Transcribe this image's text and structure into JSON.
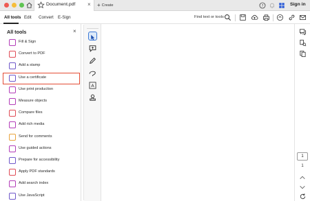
{
  "window": {
    "tab_title": "Document.pdf",
    "create_label": "Create",
    "sign_in_label": "Sign in"
  },
  "menu": {
    "items": [
      "All tools",
      "Edit",
      "Convert",
      "E-Sign"
    ],
    "active": "All tools",
    "find_label": "Find text or tools"
  },
  "panel": {
    "title": "All tools",
    "highlighted_item": "Use a certificate",
    "tools": [
      {
        "label": "Fill & Sign",
        "icon": "fill-sign-icon",
        "color": "#b23cb8"
      },
      {
        "label": "Convert to PDF",
        "icon": "convert-pdf-icon",
        "color": "#e04b55"
      },
      {
        "label": "Add a stamp",
        "icon": "stamp-icon",
        "color": "#6e57c9"
      },
      {
        "label": "Use a certificate",
        "icon": "certificate-icon",
        "color": "#6e57c9"
      },
      {
        "label": "Use print production",
        "icon": "print-production-icon",
        "color": "#b23cb8"
      },
      {
        "label": "Measure objects",
        "icon": "measure-icon",
        "color": "#b23cb8"
      },
      {
        "label": "Compare files",
        "icon": "compare-files-icon",
        "color": "#e04b55"
      },
      {
        "label": "Add rich media",
        "icon": "rich-media-icon",
        "color": "#b23cb8"
      },
      {
        "label": "Send for comments",
        "icon": "send-comments-icon",
        "color": "#e8a33c"
      },
      {
        "label": "Use guided actions",
        "icon": "guided-actions-icon",
        "color": "#b23cb8"
      },
      {
        "label": "Prepare for accessibility",
        "icon": "accessibility-icon",
        "color": "#6e57c9"
      },
      {
        "label": "Apply PDF standards",
        "icon": "pdf-standards-icon",
        "color": "#e04b55"
      },
      {
        "label": "Add search index",
        "icon": "search-index-icon",
        "color": "#b23cb8"
      },
      {
        "label": "Use JavaScript",
        "icon": "javascript-icon",
        "color": "#6e57c9"
      }
    ]
  },
  "page_nav": {
    "current_page": "1",
    "total_pages": "1"
  },
  "colors": {
    "accent": "#3a78d6",
    "highlight_border": "#e34a33"
  }
}
